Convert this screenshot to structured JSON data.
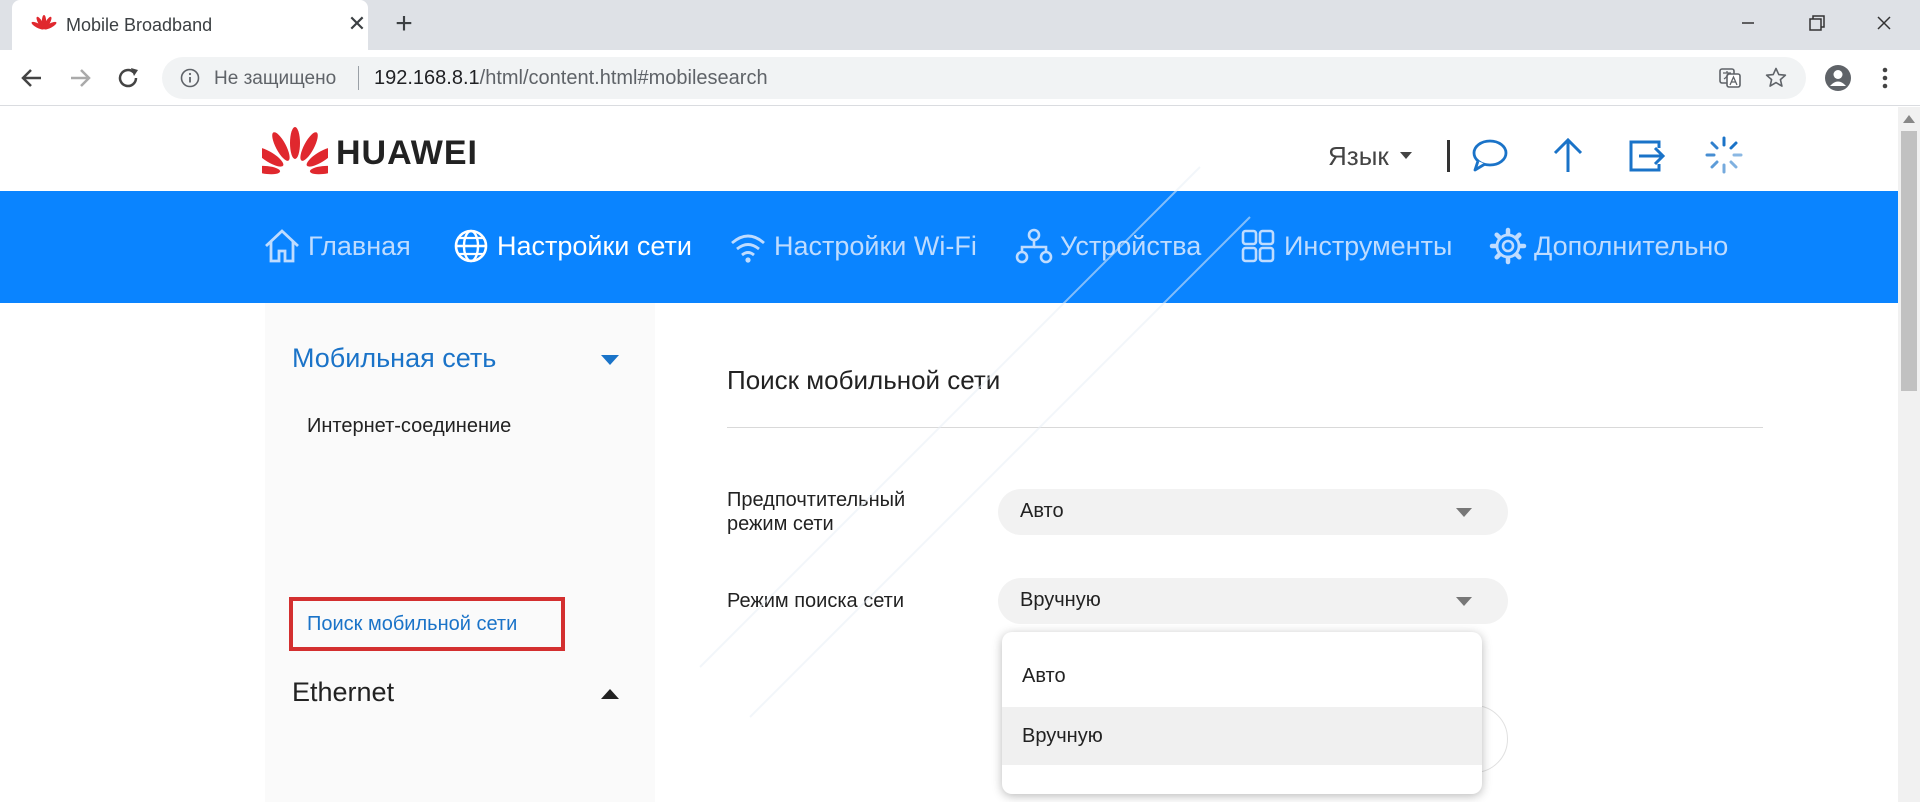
{
  "browser": {
    "tab_title": "Mobile Broadband",
    "tab_close": "✕",
    "new_tab": "+",
    "security_label": "Не защищено",
    "url_host": "192.168.8.1",
    "url_path": "/html/content.html#mobilesearch"
  },
  "header": {
    "logo_text": "HUAWEI",
    "language_label": "Язык"
  },
  "nav": {
    "items": [
      {
        "label": "Главная",
        "icon": "home-icon"
      },
      {
        "label": "Настройки сети",
        "icon": "globe-icon",
        "active": true
      },
      {
        "label": "Настройки Wi-Fi",
        "icon": "wifi-icon"
      },
      {
        "label": "Устройства",
        "icon": "devices-icon"
      },
      {
        "label": "Инструменты",
        "icon": "tools-icon"
      },
      {
        "label": "Дополнительно",
        "icon": "gear-icon"
      }
    ]
  },
  "sidebar": {
    "group_mobile": "Мобильная сеть",
    "item_internet": "Интернет-соединение",
    "item_search": "Поиск мобильной сети",
    "group_ethernet": "Ethernet"
  },
  "content": {
    "title": "Поиск мобильной сети",
    "preferred_mode_label_line1": "Предпочтительный",
    "preferred_mode_label_line2": "режим сети",
    "preferred_mode_value": "Авто",
    "search_mode_label": "Режим поиска сети",
    "search_mode_value": "Вручную",
    "dropdown_options": [
      "Авто",
      "Вручную"
    ]
  },
  "colors": {
    "navbar": "#0a84ff",
    "link_blue": "#1a73c8",
    "highlight_red": "#d32f2f",
    "huawei_red": "#e0282e"
  }
}
